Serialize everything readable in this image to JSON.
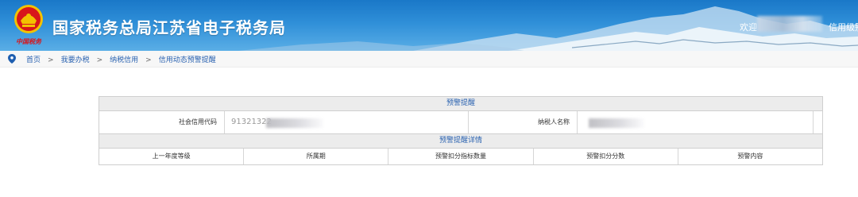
{
  "header": {
    "title": "国家税务总局江苏省电子税务局",
    "emblem_text": "中国税务",
    "welcome": "欢迎",
    "credit_link": "信用级别"
  },
  "breadcrumb": [
    "首页",
    "我要办税",
    "纳税信用",
    "信用动态预警提醒"
  ],
  "breadcrumb_separator": ">",
  "warning_section": {
    "title": "预警提醒",
    "credit_code_label": "社会信用代码",
    "credit_code_value": "91321322",
    "taxpayer_name_label": "纳税人名称"
  },
  "detail_section": {
    "title": "预警提醒详情",
    "columns": [
      "上一年度等级",
      "所属期",
      "预警扣分指标数量",
      "预警扣分分数",
      "预警内容"
    ]
  },
  "colors": {
    "banner_blue": "#1a78c8",
    "link_blue": "#2a62b0",
    "emblem_red": "#d8161b",
    "emblem_gold": "#f2c200"
  }
}
